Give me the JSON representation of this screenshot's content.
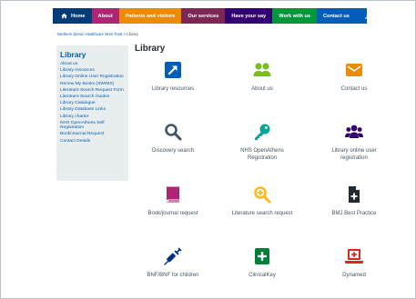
{
  "nav": {
    "home": "Home",
    "about": "About",
    "patients": "Patients and visitors",
    "services": "Our services",
    "say": "Have your say",
    "work": "Work with us",
    "contact": "Contact us"
  },
  "breadcrumb": {
    "trust": "Northern Devon Healthcare NHS Trust",
    "separator": " > ",
    "current": "Library"
  },
  "sidebar": {
    "title": "Library",
    "items": [
      "About us",
      "Library resources",
      "Library Online User Registration",
      "Renew My Books (SWIMS)",
      "Literature Search Request Form",
      "Literature Search Guides",
      "Library Catalogue",
      "Library Database Links",
      "Library charter",
      "NHS OpenAthens Self Registration",
      "Book/Journal Request",
      "Contact Details"
    ]
  },
  "page_title": "Library",
  "tiles": [
    {
      "label": "Library resources",
      "icon": "external-link-icon",
      "color": "#005eb8"
    },
    {
      "label": "About us",
      "icon": "users-icon",
      "color": "#78be20"
    },
    {
      "label": "Contact us",
      "icon": "envelope-icon",
      "color": "#ed8b00"
    },
    {
      "label": "Discovery search",
      "icon": "search-icon",
      "color": "#425563"
    },
    {
      "label": "NHS OpenAthens Registration",
      "icon": "key-icon",
      "color": "#00a499"
    },
    {
      "label": "Library online user registration",
      "icon": "user-group-icon",
      "color": "#330072"
    },
    {
      "label": "Book/journal request",
      "icon": "book-icon",
      "color": "#ae2573"
    },
    {
      "label": "Literature search request",
      "icon": "search-plus-icon",
      "color": "#ffb81c"
    },
    {
      "label": "BMJ Best Practice",
      "icon": "file-medical-icon",
      "color": "#212b32"
    },
    {
      "label": "BNF/BNF for children",
      "icon": "syringe-icon",
      "color": "#003087"
    },
    {
      "label": "ClinicalKey",
      "icon": "first-aid-icon",
      "color": "#007f3b"
    },
    {
      "label": "Dynamed",
      "icon": "laptop-medical-icon",
      "color": "#da291c"
    }
  ]
}
